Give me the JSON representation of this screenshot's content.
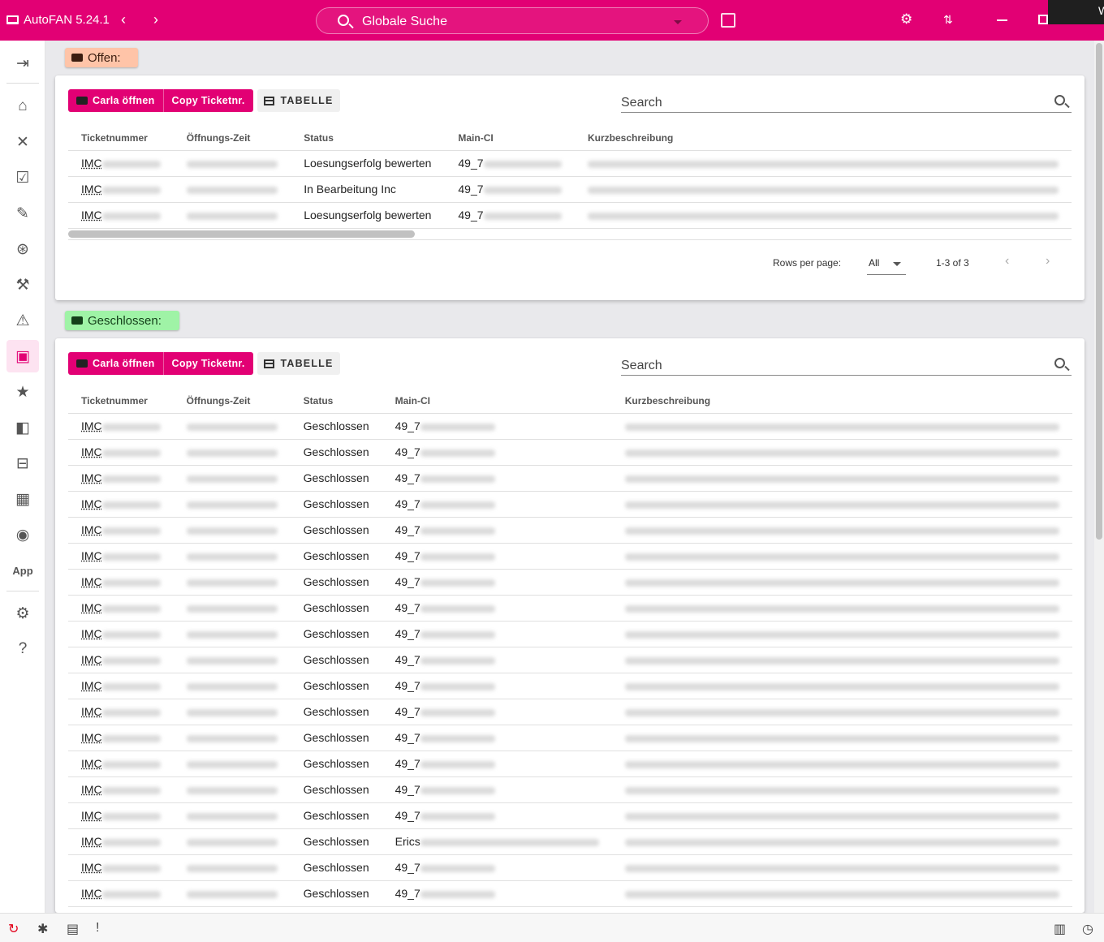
{
  "app": {
    "title": "AutoFAN 5.24.1",
    "back_icon": "‹",
    "forward_icon": "›",
    "window_edge_text": "W"
  },
  "global_search": {
    "placeholder": "Globale Suche"
  },
  "sidebar": {
    "app_label": "App"
  },
  "sections": {
    "open": {
      "label": "Offen:",
      "buttons": {
        "carla": "Carla öffnen",
        "copy": "Copy Ticketnr.",
        "table": "TABELLE"
      },
      "search_label": "Search",
      "columns": [
        "Ticketnummer",
        "Öffnungs-Zeit",
        "Status",
        "Main-CI",
        "Kurzbeschreibung"
      ],
      "rows": [
        {
          "ticket": "IMC",
          "status": "Loesungserfolg bewerten",
          "ci": "49_7"
        },
        {
          "ticket": "IMC",
          "status": "In Bearbeitung Inc",
          "ci": "49_7"
        },
        {
          "ticket": "IMC",
          "status": "Loesungserfolg bewerten",
          "ci": "49_7"
        }
      ],
      "pagination": {
        "rows_per_page_label": "Rows per page:",
        "rows_per_page_value": "All",
        "range": "1-3 of 3"
      }
    },
    "closed": {
      "label": "Geschlossen:",
      "buttons": {
        "carla": "Carla öffnen",
        "copy": "Copy Ticketnr.",
        "table": "TABELLE"
      },
      "search_label": "Search",
      "columns": [
        "Ticketnummer",
        "Öffnungs-Zeit",
        "Status",
        "Main-CI",
        "Kurzbeschreibung"
      ],
      "rows": [
        {
          "ticket": "IMC",
          "status": "Geschlossen",
          "ci": "49_7"
        },
        {
          "ticket": "IMC",
          "status": "Geschlossen",
          "ci": "49_7"
        },
        {
          "ticket": "IMC",
          "status": "Geschlossen",
          "ci": "49_7"
        },
        {
          "ticket": "IMC",
          "status": "Geschlossen",
          "ci": "49_7"
        },
        {
          "ticket": "IMC",
          "status": "Geschlossen",
          "ci": "49_7"
        },
        {
          "ticket": "IMC",
          "status": "Geschlossen",
          "ci": "49_7"
        },
        {
          "ticket": "IMC",
          "status": "Geschlossen",
          "ci": "49_7"
        },
        {
          "ticket": "IMC",
          "status": "Geschlossen",
          "ci": "49_7"
        },
        {
          "ticket": "IMC",
          "status": "Geschlossen",
          "ci": "49_7"
        },
        {
          "ticket": "IMC",
          "status": "Geschlossen",
          "ci": "49_7"
        },
        {
          "ticket": "IMC",
          "status": "Geschlossen",
          "ci": "49_7"
        },
        {
          "ticket": "IMC",
          "status": "Geschlossen",
          "ci": "49_7"
        },
        {
          "ticket": "IMC",
          "status": "Geschlossen",
          "ci": "49_7"
        },
        {
          "ticket": "IMC",
          "status": "Geschlossen",
          "ci": "49_7"
        },
        {
          "ticket": "IMC",
          "status": "Geschlossen",
          "ci": "49_7"
        },
        {
          "ticket": "IMC",
          "status": "Geschlossen",
          "ci": "49_7"
        },
        {
          "ticket": "IMC",
          "status": "Geschlossen",
          "ci": "Erics"
        },
        {
          "ticket": "IMC",
          "status": "Geschlossen",
          "ci": "49_7"
        },
        {
          "ticket": "IMC",
          "status": "Geschlossen",
          "ci": "49_7"
        }
      ]
    }
  },
  "colors": {
    "brand": "#e20074",
    "open_badge": "#ffc4a8",
    "closed_badge": "#9ff3a6"
  }
}
